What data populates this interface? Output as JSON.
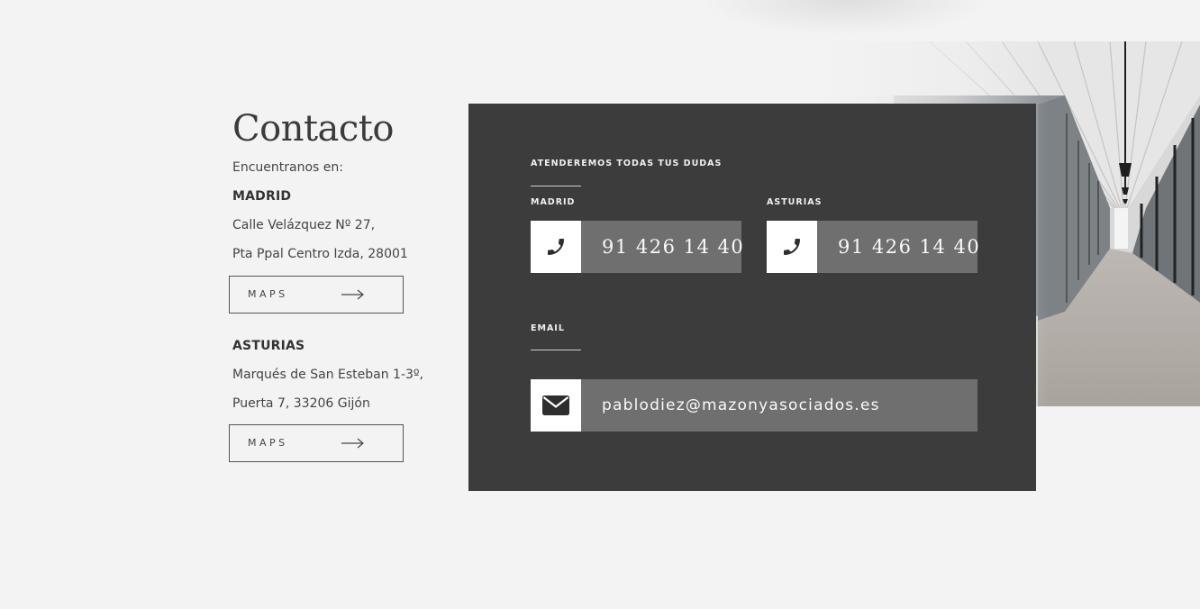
{
  "left": {
    "title": "Contacto",
    "intro": "Encuentranos en:",
    "offices": [
      {
        "city": "MADRID",
        "address_line1": "Calle Velázquez Nº 27,",
        "address_line2": "Pta Ppal Centro Izda, 28001",
        "maps_label": "MAPS"
      },
      {
        "city": "ASTURIAS",
        "address_line1": "Marqués de San Esteban 1-3º,",
        "address_line2": "Puerta 7, 33206 Gijón",
        "maps_label": "MAPS"
      }
    ]
  },
  "panel": {
    "heading": "ATENDEREMOS TODAS TUS DUDAS",
    "phones": [
      {
        "label": "MADRID",
        "number": "91 426 14 40",
        "icon": "phone-icon"
      },
      {
        "label": "ASTURIAS",
        "number": "91 426 14 40",
        "icon": "phone-icon"
      }
    ],
    "email_label": "EMAIL",
    "email": "pablodiez@mazonyasociados.es",
    "email_icon": "envelope-icon"
  },
  "colors": {
    "background": "#f3f3f3",
    "panel": "#3c3c3c",
    "value_box": "#6f6f6f",
    "icon_box": "#ffffff"
  }
}
